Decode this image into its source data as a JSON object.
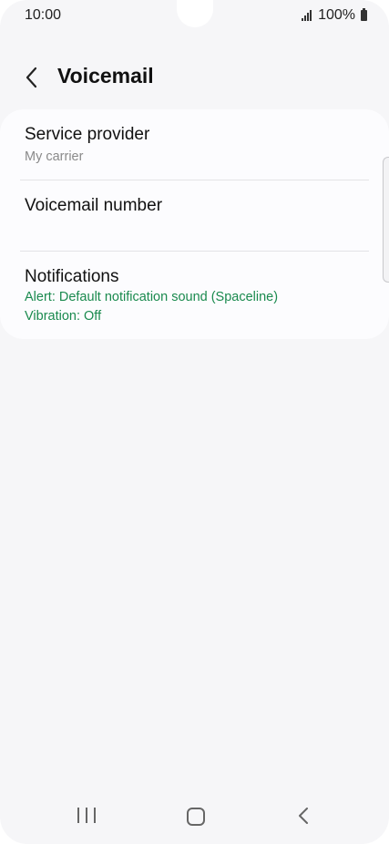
{
  "status_bar": {
    "time": "10:00",
    "battery": "100%",
    "icons": [
      "signal-icon",
      "battery-icon"
    ]
  },
  "header": {
    "back_icon": "chevron-left-icon",
    "title": "Voicemail"
  },
  "settings": {
    "items": [
      {
        "title": "Service provider",
        "subtitle": "My carrier"
      },
      {
        "title": "Voicemail number"
      },
      {
        "title": "Notifications",
        "subtitle": "Alert: Default notification sound (Spaceline)",
        "subtitle2": "Vibration: Off"
      }
    ]
  },
  "colors": {
    "background": "#f6f6f8",
    "card": "#fcfcfe",
    "accent_green": "#1a8a4e",
    "secondary_gray": "#8a8a8a"
  },
  "nav_bar": {
    "icons": [
      "recent-apps-icon",
      "home-icon",
      "back-icon"
    ]
  }
}
